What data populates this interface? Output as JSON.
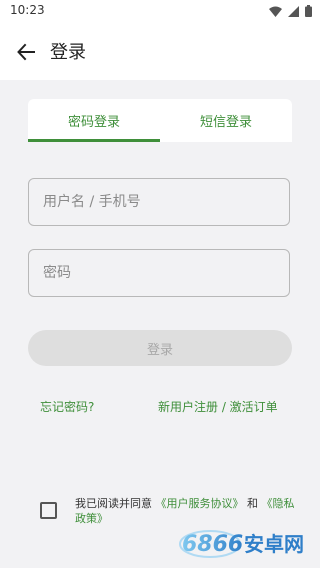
{
  "status": {
    "time": "10:23"
  },
  "header": {
    "title": "登录"
  },
  "tabs": [
    {
      "label": "密码登录"
    },
    {
      "label": "短信登录"
    }
  ],
  "form": {
    "username": {
      "placeholder": "用户名 / 手机号",
      "value": ""
    },
    "password": {
      "placeholder": "密码",
      "value": ""
    },
    "login_label": "登录"
  },
  "links": {
    "forgot": "忘记密码?",
    "register": "新用户注册 / 激活订单"
  },
  "agreement": {
    "prefix": "我已阅读并同意",
    "user_agreement": "《用户服务协议》",
    "and": "和",
    "privacy": "《隐私政策》"
  },
  "watermark": "6866安卓网",
  "colors": {
    "accent": "#3f8f3a",
    "background": "#f2f2f4"
  }
}
